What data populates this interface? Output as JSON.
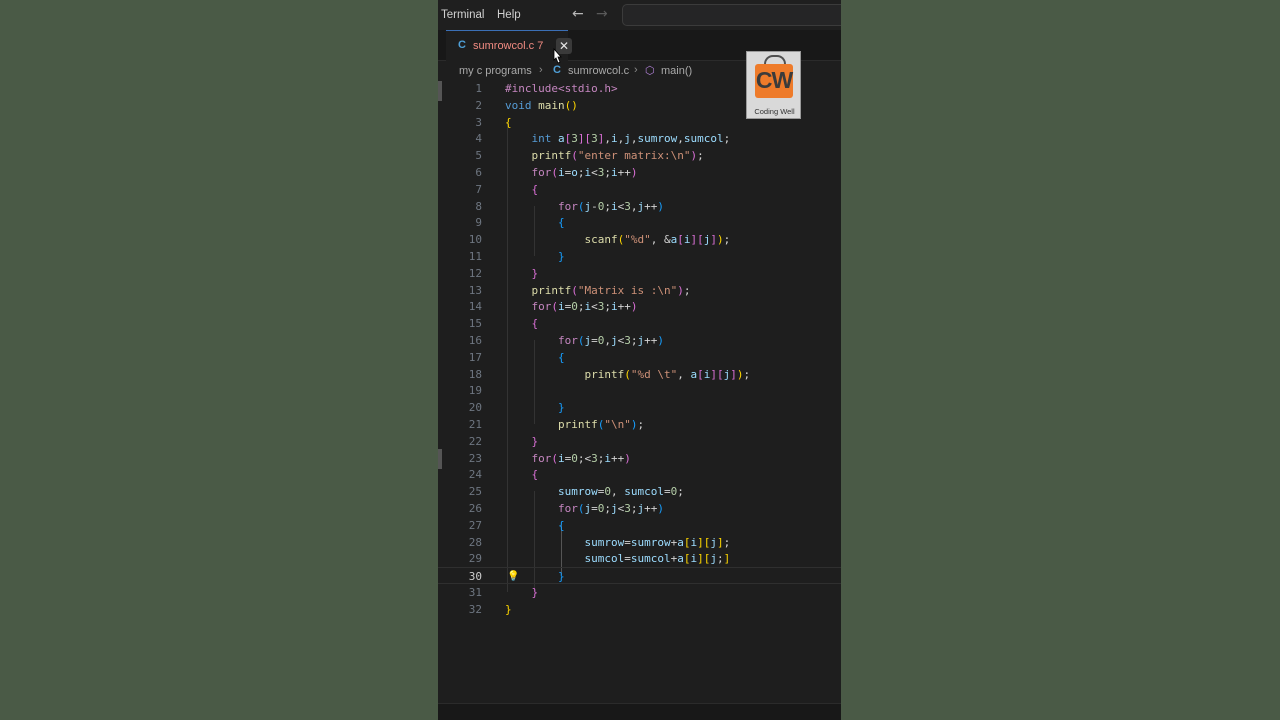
{
  "menubar": {
    "items": [
      "Terminal",
      "Help"
    ]
  },
  "tab": {
    "icon": "C",
    "filename": "sumrowcol.c",
    "problems": "7",
    "close": "✕"
  },
  "breadcrumb": {
    "folder": "my c programs",
    "file_icon": "C",
    "file": "sumrowcol.c",
    "symbol": "main()"
  },
  "logo": {
    "letters": "CW",
    "caption": "Coding Well"
  },
  "editor": {
    "current_line": 30,
    "lines": [
      {
        "n": "1",
        "text": "#include<stdio.h>"
      },
      {
        "n": "2",
        "text": "void main()"
      },
      {
        "n": "3",
        "text": "{"
      },
      {
        "n": "4",
        "text": "    int a[3][3],i,j,sumrow,sumcol;"
      },
      {
        "n": "5",
        "text": "    printf(\"enter matrix:\\n\");"
      },
      {
        "n": "6",
        "text": "    for(i=o;i<3;i++)"
      },
      {
        "n": "7",
        "text": "    {"
      },
      {
        "n": "8",
        "text": "        for(j-0;i<3,j++)"
      },
      {
        "n": "9",
        "text": "        {"
      },
      {
        "n": "10",
        "text": "            scanf(\"%d\", &a[i][j]);"
      },
      {
        "n": "11",
        "text": "        }"
      },
      {
        "n": "12",
        "text": "    }"
      },
      {
        "n": "13",
        "text": "    printf(\"Matrix is :\\n\");"
      },
      {
        "n": "14",
        "text": "    for(i=0;i<3;i++)"
      },
      {
        "n": "15",
        "text": "    {"
      },
      {
        "n": "16",
        "text": "        for(j=0,j<3;j++)"
      },
      {
        "n": "17",
        "text": "        {"
      },
      {
        "n": "18",
        "text": "            printf(\"%d \\t\", a[i][j]);"
      },
      {
        "n": "19",
        "text": ""
      },
      {
        "n": "20",
        "text": "        }"
      },
      {
        "n": "21",
        "text": "        printf(\"\\n\");"
      },
      {
        "n": "22",
        "text": "    }"
      },
      {
        "n": "23",
        "text": "    for(i=0;<3;i++)"
      },
      {
        "n": "24",
        "text": "    {"
      },
      {
        "n": "25",
        "text": "        sumrow=0, sumcol=0;"
      },
      {
        "n": "26",
        "text": "        for(j=0;j<3;j++)"
      },
      {
        "n": "27",
        "text": "        {"
      },
      {
        "n": "28",
        "text": "            sumrow=sumrow+a[i][j];"
      },
      {
        "n": "29",
        "text": "            sumcol=sumcol+a[i][j;]"
      },
      {
        "n": "30",
        "text": "        }"
      },
      {
        "n": "31",
        "text": "    }"
      },
      {
        "n": "32",
        "text": "}"
      }
    ]
  },
  "colors": {
    "background": "#4a5a46",
    "editor_bg": "#1e1e1e",
    "tab_modified": "#f28b82",
    "keyword": "#569cd6",
    "control": "#c586c0",
    "string": "#ce9178",
    "function": "#dcdcaa",
    "variable": "#9cdcfe"
  },
  "icons": [
    "back-arrow-icon",
    "forward-arrow-icon",
    "close-icon",
    "chevron-right-icon",
    "cube-icon",
    "lightbulb-icon",
    "c-file-icon"
  ]
}
